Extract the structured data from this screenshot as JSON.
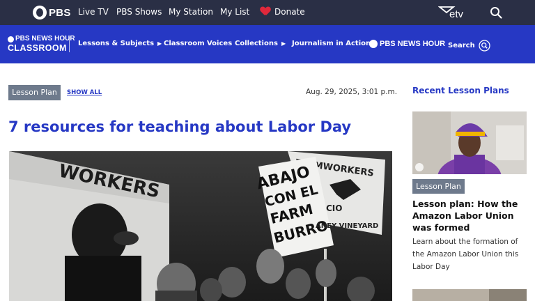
{
  "topbar": {
    "logo": "PBS",
    "nav": [
      "Live TV",
      "PBS Shows",
      "My Station",
      "My List"
    ],
    "donate": "Donate",
    "station_logo": "etv",
    "search_icon": "search-icon"
  },
  "classroom_nav": {
    "logo_line1": "PBS NEWS HOUR",
    "logo_line2": "CLASSROOM",
    "items": [
      "Lessons & Subjects",
      "Classroom Voices",
      "Collections",
      "Journalism in Action"
    ],
    "newshour": "PBS NEWS HOUR",
    "search": "Search"
  },
  "article": {
    "badge": "Lesson Plan",
    "show_all": "SHOW ALL",
    "date": "Aug. 29, 2025, 3:01 p.m.",
    "title": "7 resources for teaching about Labor Day",
    "image_signs": [
      "WORKERS",
      "FARMWORKERS",
      "ABAJO",
      "CON EL",
      "FARM",
      "BURRO",
      "CIO",
      "ANEY VINEYARD"
    ]
  },
  "sidebar": {
    "title": "Recent Lesson Plans",
    "badge": "Lesson Plan",
    "headline": "Lesson plan: How the Amazon Labor Union was formed",
    "description": "Learn about the formation of the Amazon Labor Union this Labor Day"
  },
  "colors": {
    "topbar_bg": "#2a2f45",
    "classroom_bg": "#2638c4",
    "accent_blue": "#2638c4",
    "badge_gray": "#6e7a8c",
    "heart_red": "#e0283b"
  }
}
